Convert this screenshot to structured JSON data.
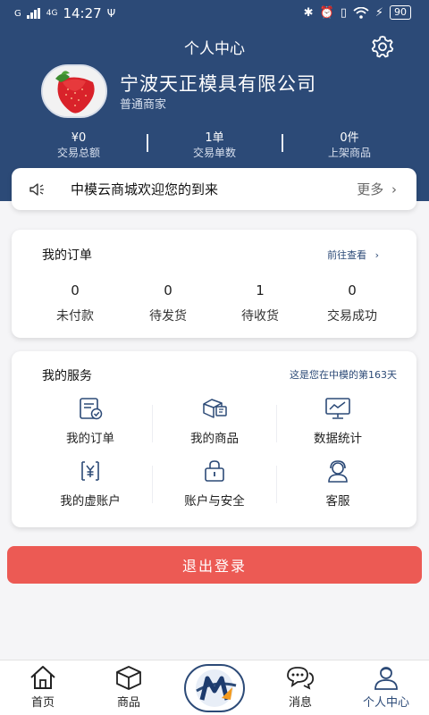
{
  "status_bar": {
    "carrier": "G",
    "network": "4G",
    "time": "14:27",
    "battery": "90"
  },
  "header": {
    "title": "个人中心"
  },
  "profile": {
    "company_name": "宁波天正模具有限公司",
    "merchant_type": "普通商家"
  },
  "stats": [
    {
      "value": "¥0",
      "label": "交易总额"
    },
    {
      "value": "1单",
      "label": "交易单数"
    },
    {
      "value": "0件",
      "label": "上架商品"
    }
  ],
  "notice": {
    "text": "中模云商城欢迎您的到来",
    "more_label": "更多"
  },
  "orders": {
    "title": "我的订单",
    "link": "前往查看",
    "items": [
      {
        "count": "0",
        "label": "未付款"
      },
      {
        "count": "0",
        "label": "待发货"
      },
      {
        "count": "1",
        "label": "待收货"
      },
      {
        "count": "0",
        "label": "交易成功"
      }
    ]
  },
  "services": {
    "title": "我的服务",
    "days_note": "这是您在中模的第163天",
    "items": [
      {
        "label": "我的订单",
        "icon": "order-icon"
      },
      {
        "label": "我的商品",
        "icon": "product-box-icon"
      },
      {
        "label": "数据统计",
        "icon": "chart-monitor-icon"
      },
      {
        "label": "我的虚账户",
        "icon": "yuan-account-icon"
      },
      {
        "label": "账户与安全",
        "icon": "lock-icon"
      },
      {
        "label": "客服",
        "icon": "customer-service-icon"
      }
    ]
  },
  "logout_label": "退出登录",
  "tabbar": {
    "items": [
      {
        "label": "首页",
        "icon": "home-icon"
      },
      {
        "label": "商品",
        "icon": "box-icon"
      },
      {
        "label": "消息",
        "icon": "message-icon"
      },
      {
        "label": "个人中心",
        "icon": "user-icon"
      }
    ],
    "active_index": 3
  },
  "colors": {
    "primary": "#2c4a77",
    "logout": "#ec5a54",
    "background": "#f5f5f7"
  }
}
